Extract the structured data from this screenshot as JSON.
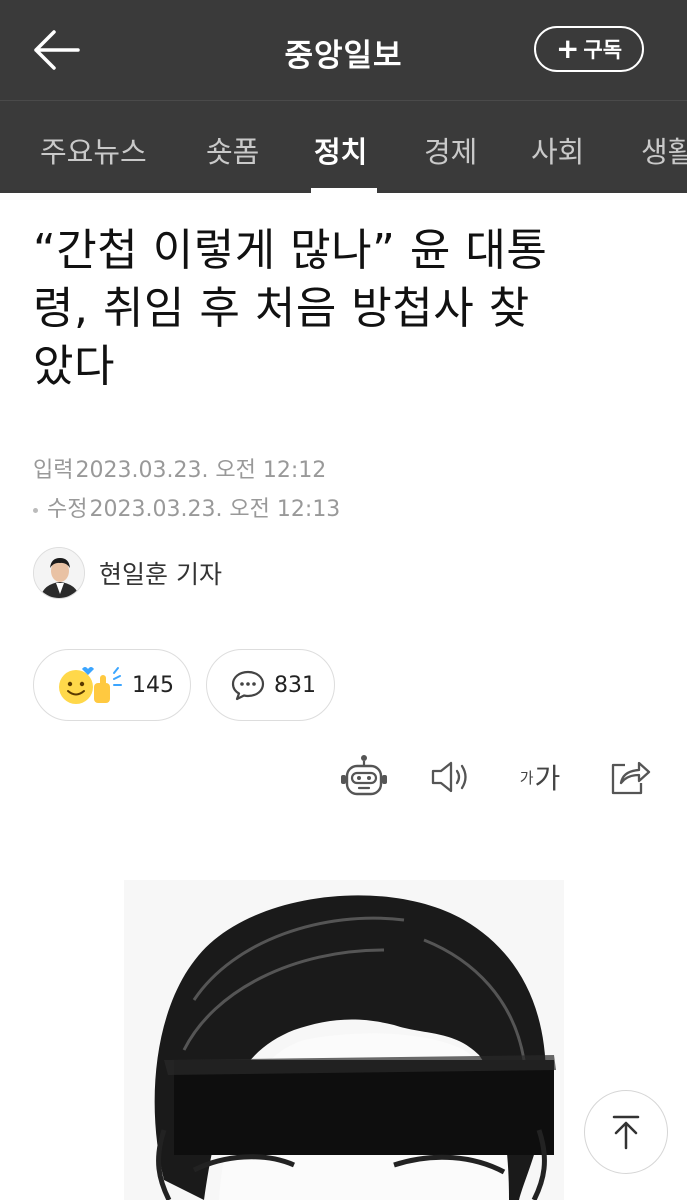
{
  "header": {
    "site_title": "중앙일보",
    "subscribe_label": "구독"
  },
  "tabs": [
    {
      "label": "주요뉴스"
    },
    {
      "label": "숏폼"
    },
    {
      "label": "정치",
      "active": true
    },
    {
      "label": "경제"
    },
    {
      "label": "사회"
    },
    {
      "label": "생활"
    }
  ],
  "article": {
    "headline_lines": [
      "“간첩 이렇게 많나” 윤 대통",
      "령, 취임 후 처음 방첩사 찾",
      "았다"
    ],
    "published_label": "입력",
    "published": "2023.03.23. 오전 12:12",
    "modified_label": "수정",
    "modified": "2023.03.23. 오전 12:13",
    "reporter": "현일훈 기자"
  },
  "reactions": {
    "like_count": "145",
    "comment_count": "831"
  },
  "tools": {
    "font_small": "가",
    "font_large": "가"
  },
  "colors": {
    "header_bg": "#3a3a3a",
    "active_tab": "#ffffff",
    "inactive_tab": "#c9c9c9",
    "meta_text": "#999999"
  }
}
